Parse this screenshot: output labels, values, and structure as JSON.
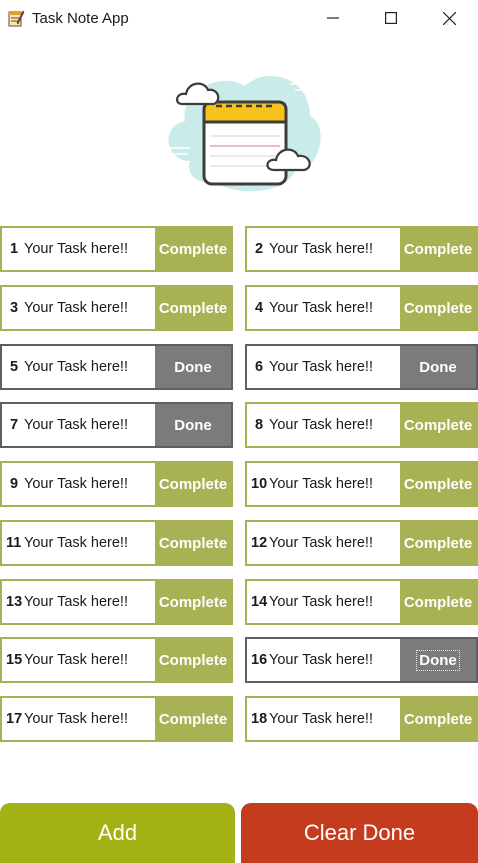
{
  "window": {
    "title": "Task Note App",
    "icons": {
      "app": "notepad-icon",
      "minimize": "minimize-icon",
      "maximize": "maximize-icon",
      "close": "close-icon"
    }
  },
  "hero": {
    "icon": "notepad-cloud-illustration"
  },
  "tasks": [
    {
      "num": "1",
      "text": "Your Task here!!",
      "button": "Complete",
      "state": "pending"
    },
    {
      "num": "2",
      "text": "Your Task here!!",
      "button": "Complete",
      "state": "pending"
    },
    {
      "num": "3",
      "text": "Your Task here!!",
      "button": "Complete",
      "state": "pending"
    },
    {
      "num": "4",
      "text": "Your Task here!!",
      "button": "Complete",
      "state": "pending"
    },
    {
      "num": "5",
      "text": "Your Task here!!",
      "button": "Done",
      "state": "done"
    },
    {
      "num": "6",
      "text": "Your Task here!!",
      "button": "Done",
      "state": "done"
    },
    {
      "num": "7",
      "text": "Your Task here!!",
      "button": "Done",
      "state": "done"
    },
    {
      "num": "8",
      "text": "Your Task here!!",
      "button": "Complete",
      "state": "pending"
    },
    {
      "num": "9",
      "text": "Your Task here!!",
      "button": "Complete",
      "state": "pending"
    },
    {
      "num": "10",
      "text": "Your Task here!!",
      "button": "Complete",
      "state": "pending"
    },
    {
      "num": "11",
      "text": "Your Task here!!",
      "button": "Complete",
      "state": "pending"
    },
    {
      "num": "12",
      "text": "Your Task here!!",
      "button": "Complete",
      "state": "pending"
    },
    {
      "num": "13",
      "text": "Your Task here!!",
      "button": "Complete",
      "state": "pending"
    },
    {
      "num": "14",
      "text": "Your Task here!!",
      "button": "Complete",
      "state": "pending"
    },
    {
      "num": "15",
      "text": "Your Task here!!",
      "button": "Complete",
      "state": "pending"
    },
    {
      "num": "16",
      "text": "Your Task here!!",
      "button": "Done",
      "state": "done",
      "focused": true
    },
    {
      "num": "17",
      "text": "Your Task here!!",
      "button": "Complete",
      "state": "pending"
    },
    {
      "num": "18",
      "text": "Your Task here!!",
      "button": "Complete",
      "state": "pending"
    }
  ],
  "footer": {
    "add_label": "Add",
    "clear_label": "Clear Done"
  },
  "colors": {
    "pending": "#a9b155",
    "done_button": "#7b7b7b",
    "done_border": "#5f5f5f",
    "add": "#a2b214",
    "clear": "#c43c1d"
  }
}
